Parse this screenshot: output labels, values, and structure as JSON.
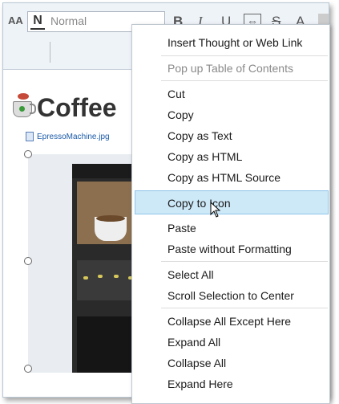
{
  "toolbar": {
    "font_size_label": "AA",
    "style_select": {
      "icon": "N",
      "value": "Normal"
    },
    "format": {
      "bold": "B",
      "italic": "I",
      "underline": "U",
      "strike": "S",
      "font_color": "A"
    },
    "icons": [
      "align-left-icon",
      "align-right-icon",
      "link-icon",
      "horizontal-rule-icon",
      "calendar-icon"
    ]
  },
  "editor": {
    "heading": "Coffee",
    "image_link": "EpressoMachine.jpg"
  },
  "context_menu": {
    "groups": [
      [
        {
          "label": "Insert Thought or Web Link",
          "enabled": true
        }
      ],
      [
        {
          "label": "Pop up Table of Contents",
          "enabled": false
        }
      ],
      [
        {
          "label": "Cut",
          "enabled": true
        },
        {
          "label": "Copy",
          "enabled": true
        },
        {
          "label": "Copy as Text",
          "enabled": true
        },
        {
          "label": "Copy as HTML",
          "enabled": true
        },
        {
          "label": "Copy as HTML Source",
          "enabled": true
        },
        {
          "label": "Copy to Icon",
          "enabled": true,
          "highlighted": true
        },
        {
          "label": "Paste",
          "enabled": true
        },
        {
          "label": "Paste without Formatting",
          "enabled": true
        }
      ],
      [
        {
          "label": "Select All",
          "enabled": true
        },
        {
          "label": "Scroll Selection to Center",
          "enabled": true
        }
      ],
      [
        {
          "label": "Collapse All Except Here",
          "enabled": true
        },
        {
          "label": "Expand All",
          "enabled": true
        },
        {
          "label": "Collapse All",
          "enabled": true
        },
        {
          "label": "Expand Here",
          "enabled": true
        }
      ]
    ]
  },
  "colors": {
    "highlight": "#cde8f7",
    "highlight_border": "#8ec5e8",
    "link": "#1a5aa8"
  }
}
